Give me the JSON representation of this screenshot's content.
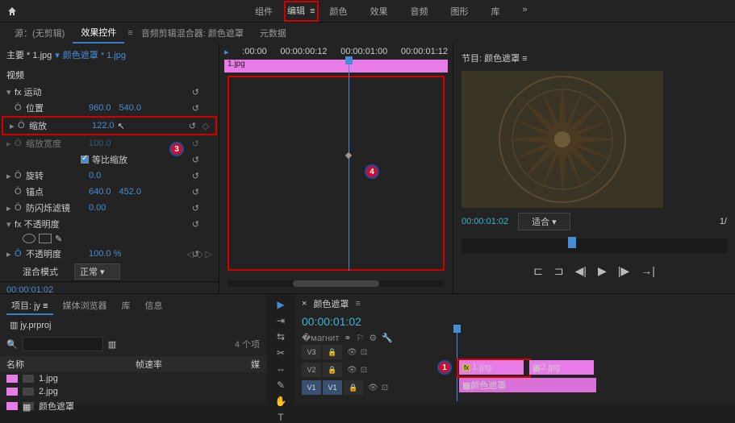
{
  "topbar": {
    "tabs": [
      "组件",
      "编辑",
      "颜色",
      "效果",
      "音频",
      "图形",
      "库"
    ],
    "active": 1
  },
  "subbar": {
    "items": [
      "源：(无剪辑)",
      "效果控件",
      "音频剪辑混合器: 颜色遮罩",
      "元数据"
    ],
    "active": 1
  },
  "effects": {
    "master": "主要 * 1.jpg",
    "clip": "颜色遮罩 * 1.jpg",
    "section_video": "视频",
    "motion": "fx 运动",
    "position": {
      "label": "位置",
      "x": "960.0",
      "y": "540.0"
    },
    "scale": {
      "label": "缩放",
      "val": "122.0"
    },
    "scale_w": {
      "label": "缩放宽度",
      "val": "100.0"
    },
    "uniform": "等比缩放",
    "rotation": {
      "label": "旋转",
      "val": "0.0"
    },
    "anchor": {
      "label": "锚点",
      "x": "640.0",
      "y": "452.0"
    },
    "flicker": {
      "label": "防闪烁滤镜",
      "val": "0.00"
    },
    "opacity_sec": "fx 不透明度",
    "opacity": {
      "label": "不透明度",
      "val": "100.0 %"
    },
    "blend": {
      "label": "混合模式",
      "val": "正常"
    },
    "tc": "00:00:01:02"
  },
  "center": {
    "times": [
      ":00:00",
      "00:00:00:12",
      "00:00:01:00",
      "00:00:01:12"
    ],
    "clip": "1.jpg"
  },
  "program": {
    "title": "节目: 颜色遮罩",
    "tc": "00:00:01:02",
    "fit": "适合",
    "ratio": "1/"
  },
  "project": {
    "tabs": [
      "项目: jy",
      "媒体浏览器",
      "库",
      "信息"
    ],
    "active": 0,
    "file": "jy.prproj",
    "count": "4 个项",
    "cols": [
      "名称",
      "帧速率",
      "媒"
    ],
    "items": [
      "1.jpg",
      "2.jpg",
      "颜色遮罩"
    ]
  },
  "timeline": {
    "name": "颜色遮罩",
    "tc": "00:00:01:02",
    "clip1": "1.jpg",
    "clip2": "2.jpg",
    "v1": "V1",
    "v2": "V2",
    "v3": "V3",
    "clip3": "颜色遮罩"
  },
  "badges": {
    "b1": "1",
    "b3": "3",
    "b4": "4"
  }
}
